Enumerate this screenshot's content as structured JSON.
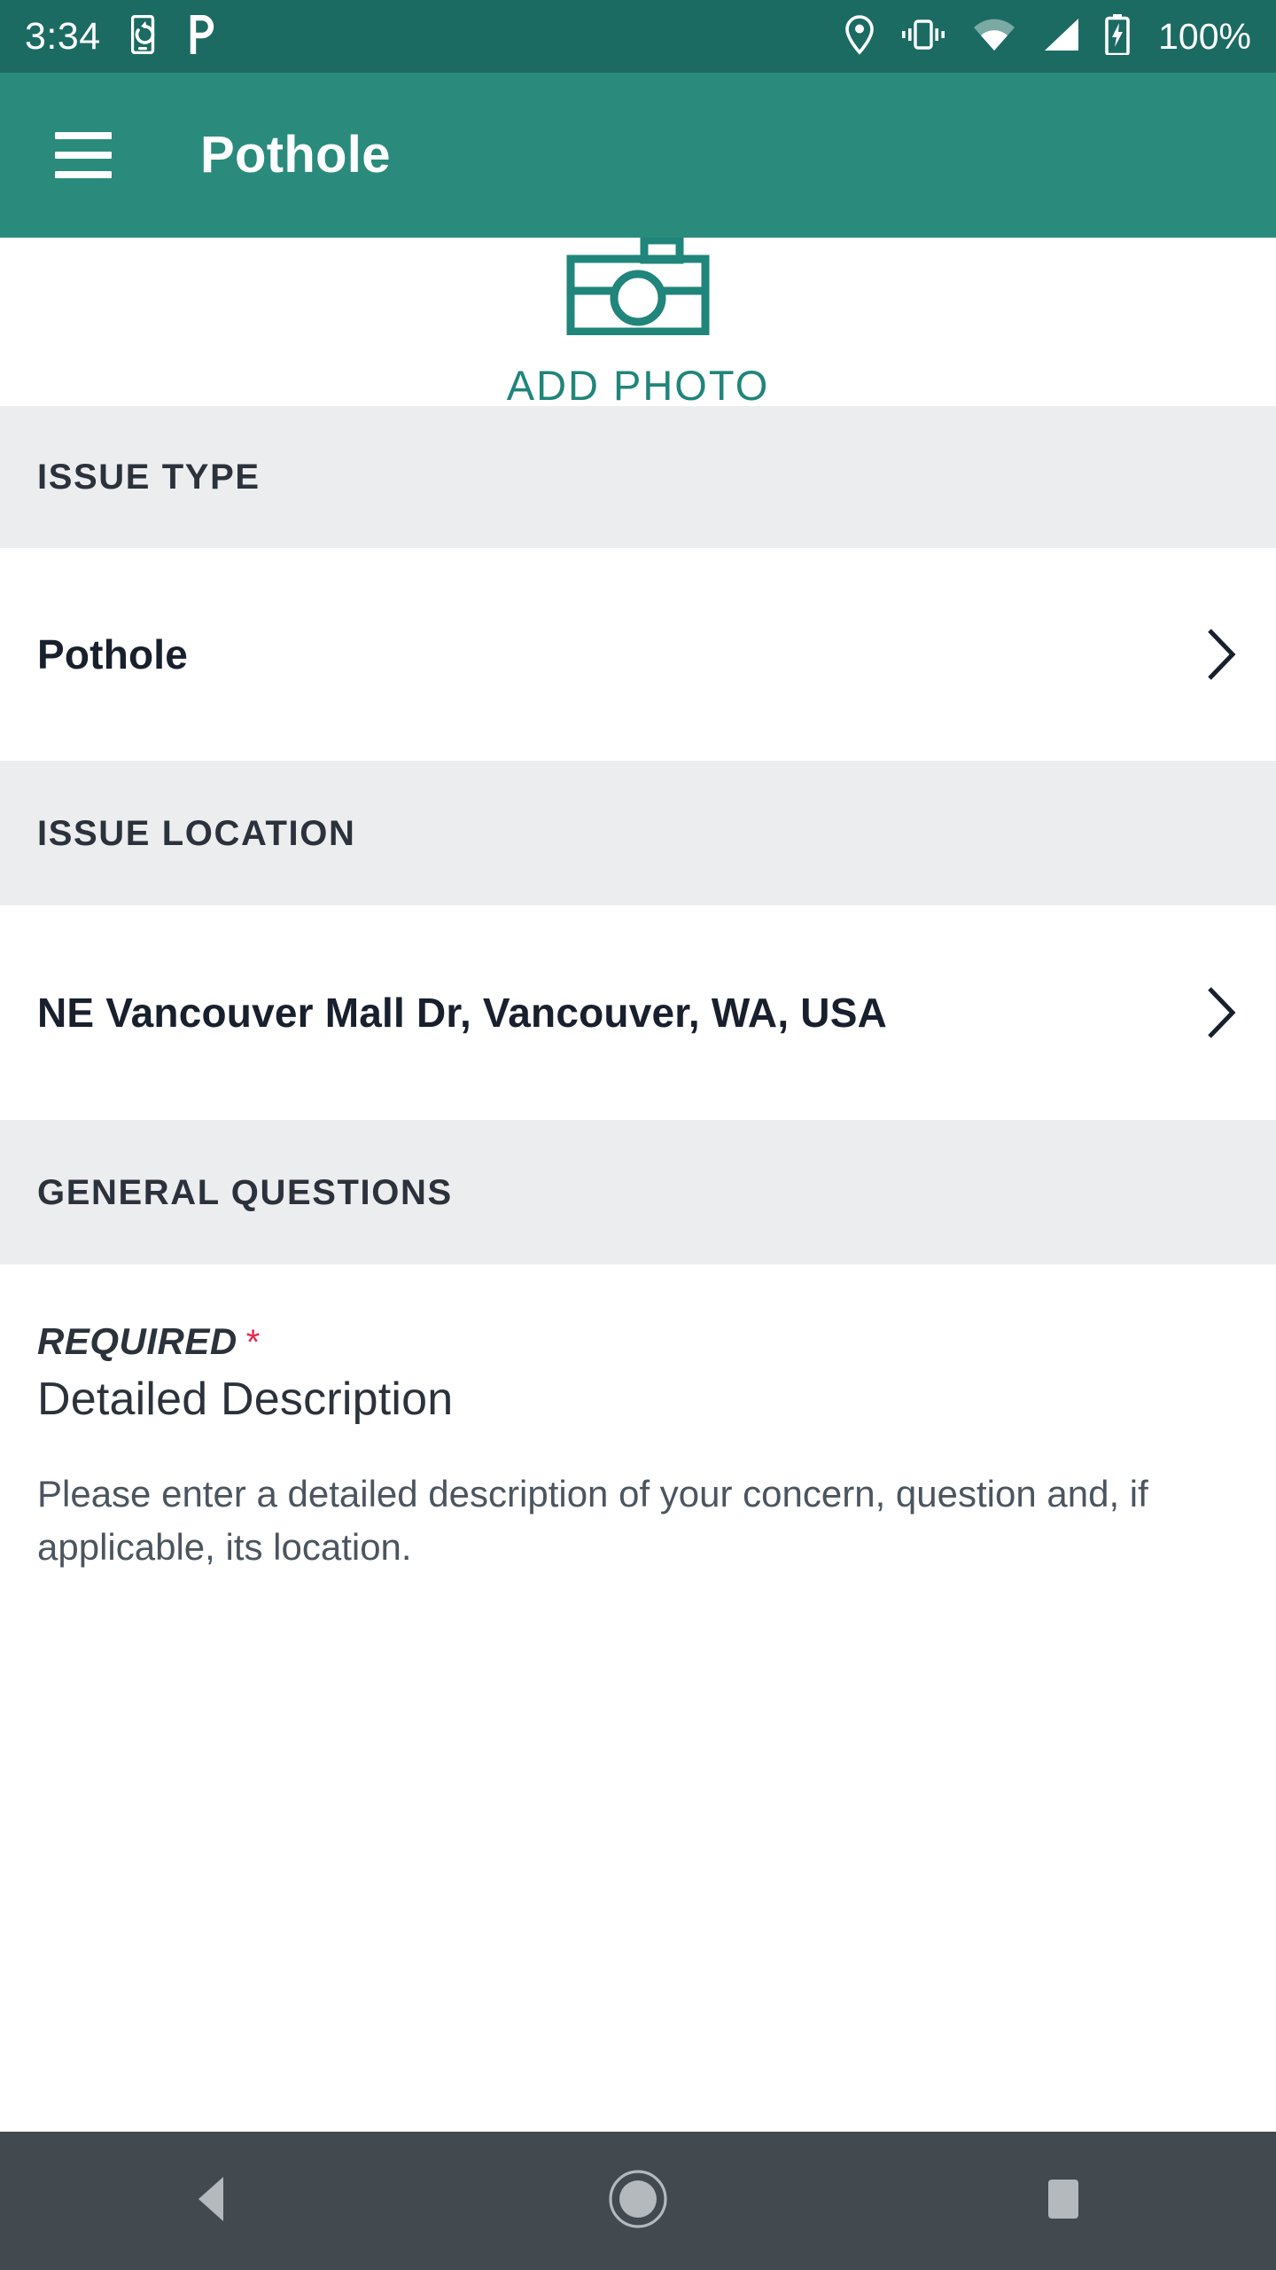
{
  "status_bar": {
    "clock": "3:34",
    "battery_text": "100%",
    "background_color": "#1c6b63",
    "icons_left": [
      "screen-rotate-icon",
      "parking-p-icon"
    ],
    "icons_right": [
      "location-pin-icon",
      "vibrate-icon",
      "wifi-icon",
      "cellular-signal-icon",
      "battery-charging-icon"
    ]
  },
  "app_bar": {
    "title": "Pothole",
    "menu_icon": "hamburger-menu-icon",
    "background_color": "#2a8b7c"
  },
  "photo": {
    "icon": "camera-icon",
    "label": "ADD PHOTO",
    "accent_color": "#20857a"
  },
  "sections": {
    "issue_type": {
      "header": "ISSUE TYPE",
      "value": "Pothole",
      "chevron": "chevron-right-icon"
    },
    "issue_location": {
      "header": "ISSUE LOCATION",
      "value": "NE Vancouver Mall Dr, Vancouver, WA, USA",
      "chevron": "chevron-right-icon"
    },
    "general_questions": {
      "header": "GENERAL QUESTIONS",
      "required_label": "REQUIRED",
      "required_star": "*",
      "required_star_color": "#e8254d",
      "question_title": "Detailed Description",
      "question_body": "Please enter a detailed description of your concern, question and, if applicable, its location."
    }
  },
  "nav_bar": {
    "background_color": "#424a50",
    "back": "back-triangle-icon",
    "home": "home-circle-icon",
    "recents": "recents-square-icon"
  }
}
